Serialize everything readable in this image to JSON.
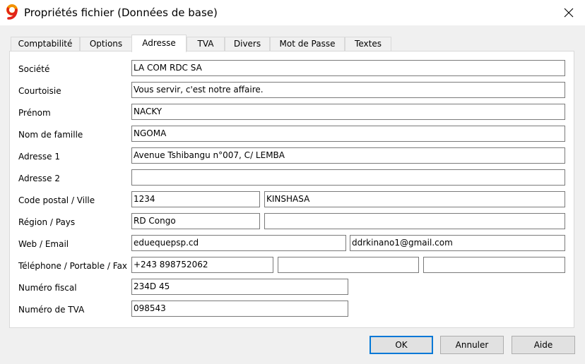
{
  "window": {
    "title": "Propriétés fichier (Données de base)"
  },
  "tabs": [
    {
      "label": "Comptabilité"
    },
    {
      "label": "Options"
    },
    {
      "label": "Adresse",
      "active": true
    },
    {
      "label": "TVA"
    },
    {
      "label": "Divers"
    },
    {
      "label": "Mot de Passe"
    },
    {
      "label": "Textes"
    }
  ],
  "form": {
    "societe": {
      "label": "Société",
      "value": "LA COM  RDC SA"
    },
    "courtoisie": {
      "label": "Courtoisie",
      "value": "Vous servir, c'est notre affaire."
    },
    "prenom": {
      "label": "Prénom",
      "value": "NACKY"
    },
    "nom": {
      "label": "Nom de famille",
      "value": "NGOMA"
    },
    "adresse1": {
      "label": "Adresse 1",
      "value": "Avenue Tshibangu n°007, C/ LEMBA"
    },
    "adresse2": {
      "label": "Adresse 2",
      "value": ""
    },
    "code_ville": {
      "label": "Code postal / Ville",
      "code": "1234",
      "ville": "KINSHASA"
    },
    "region_pays": {
      "label": "Région / Pays",
      "region": "RD Congo",
      "pays": ""
    },
    "web_email": {
      "label": "Web / Email",
      "web": "eduequepsp.cd",
      "email": "ddrkinano1@gmail.com"
    },
    "telephone": {
      "label": "Téléphone / Portable / Fax",
      "telephone": "+243 898752062",
      "portable": "",
      "fax": ""
    },
    "numero_fiscal": {
      "label": "Numéro fiscal",
      "value": "234D 45"
    },
    "numero_tva": {
      "label": "Numéro de TVA",
      "value": "098543"
    }
  },
  "buttons": {
    "ok": "OK",
    "annuler": "Annuler",
    "aide": "Aide"
  },
  "colors": {
    "accent": "#0078d7",
    "logo_red": "#e2231a",
    "logo_orange": "#f39200"
  },
  "icons": {
    "app": "app-logo-icon",
    "close": "close-icon"
  }
}
